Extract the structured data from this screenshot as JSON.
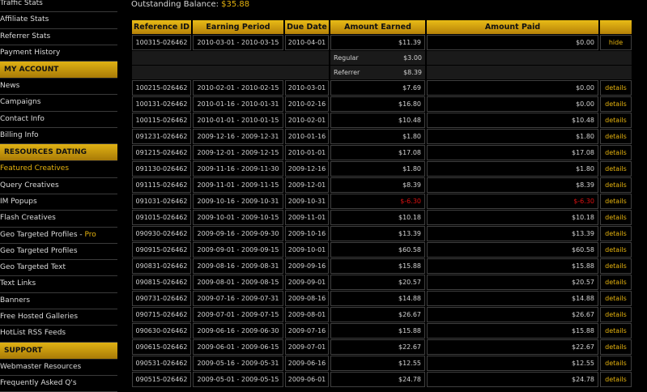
{
  "sidebar": {
    "groups": [
      {
        "heading": "",
        "items": [
          {
            "label": "Traffic Stats"
          },
          {
            "label": "Affiliate Stats"
          },
          {
            "label": "Referrer Stats"
          },
          {
            "label": "Payment History"
          }
        ]
      },
      {
        "heading": "MY ACCOUNT",
        "items": [
          {
            "label": "News"
          },
          {
            "label": "Campaigns"
          },
          {
            "label": "Contact Info"
          },
          {
            "label": "Billing Info"
          }
        ]
      },
      {
        "heading": "RESOURCES DATING",
        "items": [
          {
            "label": "Featured Creatives",
            "active": true
          },
          {
            "label": "Query Creatives"
          },
          {
            "label": "IM Popups"
          },
          {
            "label": "Flash Creatives"
          },
          {
            "label": "Geo Targeted Profiles - ",
            "pro": "Pro"
          },
          {
            "label": "Geo Targeted Profiles"
          },
          {
            "label": "Geo Targeted Text"
          },
          {
            "label": "Text Links"
          },
          {
            "label": "Banners"
          },
          {
            "label": "Free Hosted Galleries"
          },
          {
            "label": "HotList RSS Feeds"
          }
        ]
      },
      {
        "heading": "SUPPORT",
        "items": [
          {
            "label": "Webmaster Resources"
          },
          {
            "label": "Frequently Asked Q's"
          }
        ]
      }
    ]
  },
  "balance": {
    "label": "Outstanding Balance:",
    "amount": "$35.88"
  },
  "table": {
    "headers": [
      "Reference ID",
      "Earning Period",
      "Due Date",
      "Amount Earned",
      "Amount Paid",
      ""
    ],
    "breakdown": {
      "after_row": 0,
      "items": [
        {
          "label": "Regular",
          "value": "$3.00"
        },
        {
          "label": "Referrer",
          "value": "$8.39"
        }
      ]
    },
    "rows": [
      {
        "ref": "100315-026462",
        "period": "2010-03-01 - 2010-03-15",
        "due": "2010-04-01",
        "earned": "$11.39",
        "paid": "$0.00",
        "action": "hide"
      },
      {
        "ref": "100215-026462",
        "period": "2010-02-01 - 2010-02-15",
        "due": "2010-03-01",
        "earned": "$7.69",
        "paid": "$0.00",
        "action": "details"
      },
      {
        "ref": "100131-026462",
        "period": "2010-01-16 - 2010-01-31",
        "due": "2010-02-16",
        "earned": "$16.80",
        "paid": "$0.00",
        "action": "details"
      },
      {
        "ref": "100115-026462",
        "period": "2010-01-01 - 2010-01-15",
        "due": "2010-02-01",
        "earned": "$10.48",
        "paid": "$10.48",
        "action": "details"
      },
      {
        "ref": "091231-026462",
        "period": "2009-12-16 - 2009-12-31",
        "due": "2010-01-16",
        "earned": "$1.80",
        "paid": "$1.80",
        "action": "details"
      },
      {
        "ref": "091215-026462",
        "period": "2009-12-01 - 2009-12-15",
        "due": "2010-01-01",
        "earned": "$17.08",
        "paid": "$17.08",
        "action": "details"
      },
      {
        "ref": "091130-026462",
        "period": "2009-11-16 - 2009-11-30",
        "due": "2009-12-16",
        "earned": "$1.80",
        "paid": "$1.80",
        "action": "details"
      },
      {
        "ref": "091115-026462",
        "period": "2009-11-01 - 2009-11-15",
        "due": "2009-12-01",
        "earned": "$8.39",
        "paid": "$8.39",
        "action": "details"
      },
      {
        "ref": "091031-026462",
        "period": "2009-10-16 - 2009-10-31",
        "due": "2009-10-31",
        "earned": "$-6.30",
        "paid": "$-6.30",
        "action": "details",
        "negative": true
      },
      {
        "ref": "091015-026462",
        "period": "2009-10-01 - 2009-10-15",
        "due": "2009-11-01",
        "earned": "$10.18",
        "paid": "$10.18",
        "action": "details"
      },
      {
        "ref": "090930-026462",
        "period": "2009-09-16 - 2009-09-30",
        "due": "2009-10-16",
        "earned": "$13.39",
        "paid": "$13.39",
        "action": "details"
      },
      {
        "ref": "090915-026462",
        "period": "2009-09-01 - 2009-09-15",
        "due": "2009-10-01",
        "earned": "$60.58",
        "paid": "$60.58",
        "action": "details"
      },
      {
        "ref": "090831-026462",
        "period": "2009-08-16 - 2009-08-31",
        "due": "2009-09-16",
        "earned": "$15.88",
        "paid": "$15.88",
        "action": "details"
      },
      {
        "ref": "090815-026462",
        "period": "2009-08-01 - 2009-08-15",
        "due": "2009-09-01",
        "earned": "$20.57",
        "paid": "$20.57",
        "action": "details"
      },
      {
        "ref": "090731-026462",
        "period": "2009-07-16 - 2009-07-31",
        "due": "2009-08-16",
        "earned": "$14.88",
        "paid": "$14.88",
        "action": "details"
      },
      {
        "ref": "090715-026462",
        "period": "2009-07-01 - 2009-07-15",
        "due": "2009-08-01",
        "earned": "$26.67",
        "paid": "$26.67",
        "action": "details"
      },
      {
        "ref": "090630-026462",
        "period": "2009-06-16 - 2009-06-30",
        "due": "2009-07-16",
        "earned": "$15.88",
        "paid": "$15.88",
        "action": "details"
      },
      {
        "ref": "090615-026462",
        "period": "2009-06-01 - 2009-06-15",
        "due": "2009-07-01",
        "earned": "$22.67",
        "paid": "$22.67",
        "action": "details"
      },
      {
        "ref": "090531-026462",
        "period": "2009-05-16 - 2009-05-31",
        "due": "2009-06-16",
        "earned": "$12.55",
        "paid": "$12.55",
        "action": "details"
      },
      {
        "ref": "090515-026462",
        "period": "2009-05-01 - 2009-05-15",
        "due": "2009-06-01",
        "earned": "$24.78",
        "paid": "$24.78",
        "action": "details"
      }
    ]
  },
  "colors": {
    "accent": "#e6b30e",
    "negative": "#dd1111",
    "background": "#000000"
  }
}
